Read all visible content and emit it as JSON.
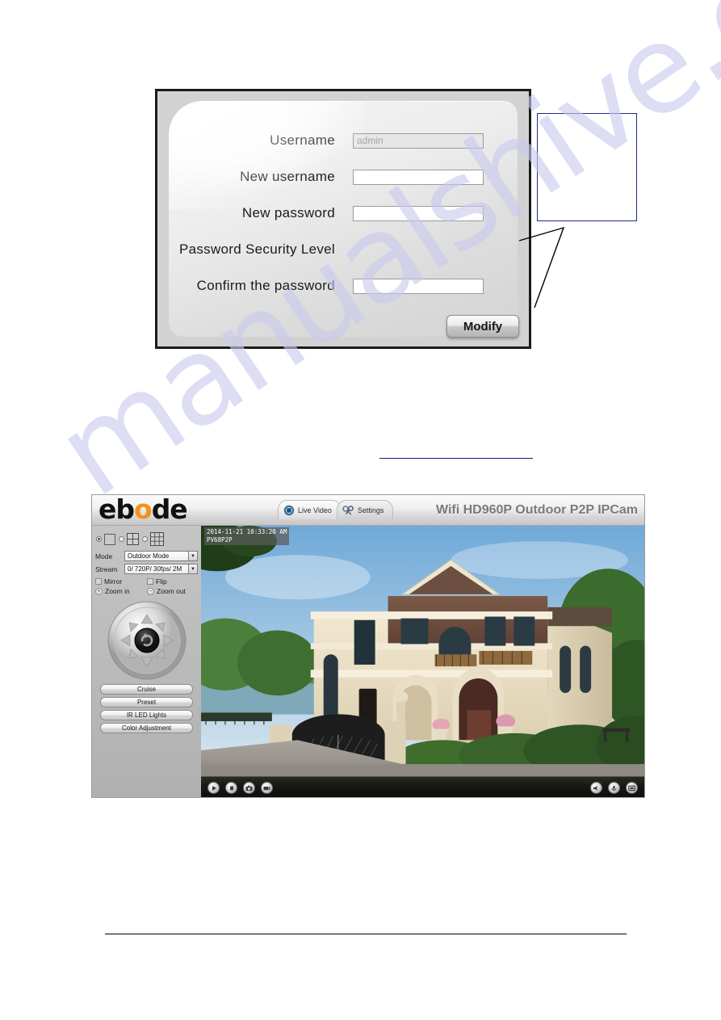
{
  "dialog": {
    "rows": [
      {
        "label": "Username",
        "value": "admin",
        "placeholder": "",
        "readonly": true
      },
      {
        "label": "New username",
        "value": "",
        "placeholder": "",
        "readonly": false
      },
      {
        "label": "New password",
        "value": "",
        "placeholder": "",
        "readonly": false
      },
      {
        "label": "Password Security Level",
        "value": null,
        "placeholder": "",
        "readonly": false
      },
      {
        "label": "Confirm the password",
        "value": "",
        "placeholder": "",
        "readonly": false
      }
    ],
    "modify_button": "Modify"
  },
  "callout": {
    "text": "",
    "border_color": "#1f2a8c"
  },
  "watermark": {
    "text": "manualshive.com",
    "color": "#c9c9ee"
  },
  "app": {
    "logo": {
      "pre": "eb",
      "accent": "o",
      "post": "de",
      "accent_color": "#f29318"
    },
    "tabs": [
      {
        "label": "Live Video",
        "icon": "camera-icon",
        "active": true
      },
      {
        "label": "Settings",
        "icon": "tools-icon",
        "active": false
      }
    ],
    "title": "Wifi HD960P Outdoor P2P IPCam",
    "controls": {
      "view_modes": [
        {
          "name": "single-view",
          "selected": true
        },
        {
          "name": "quad-view",
          "selected": false
        },
        {
          "name": "nine-view",
          "selected": false
        }
      ],
      "mode": {
        "label": "Mode",
        "value": "Outdoor Mode"
      },
      "stream": {
        "label": "Stream",
        "value": "0/ 720P/ 30fps/ 2M"
      },
      "mirror": {
        "label": "Mirror",
        "checked": false
      },
      "flip": {
        "label": "Flip",
        "checked": false
      },
      "zoom_in": {
        "label": "Zoom in",
        "sign": "+"
      },
      "zoom_out": {
        "label": "Zoom out",
        "sign": "−"
      },
      "buttons": [
        "Cruise",
        "Preset",
        "IR LED Lights",
        "Color Adjustment"
      ]
    },
    "video": {
      "osd_timestamp": "2014-11-21 10:33:20 AM",
      "osd_name": "PV68P2P",
      "toolbar_left": [
        "play-icon",
        "stop-icon",
        "snapshot-icon",
        "record-icon"
      ],
      "toolbar_right": [
        "audio-icon",
        "talk-icon",
        "fullscreen-icon"
      ]
    }
  }
}
